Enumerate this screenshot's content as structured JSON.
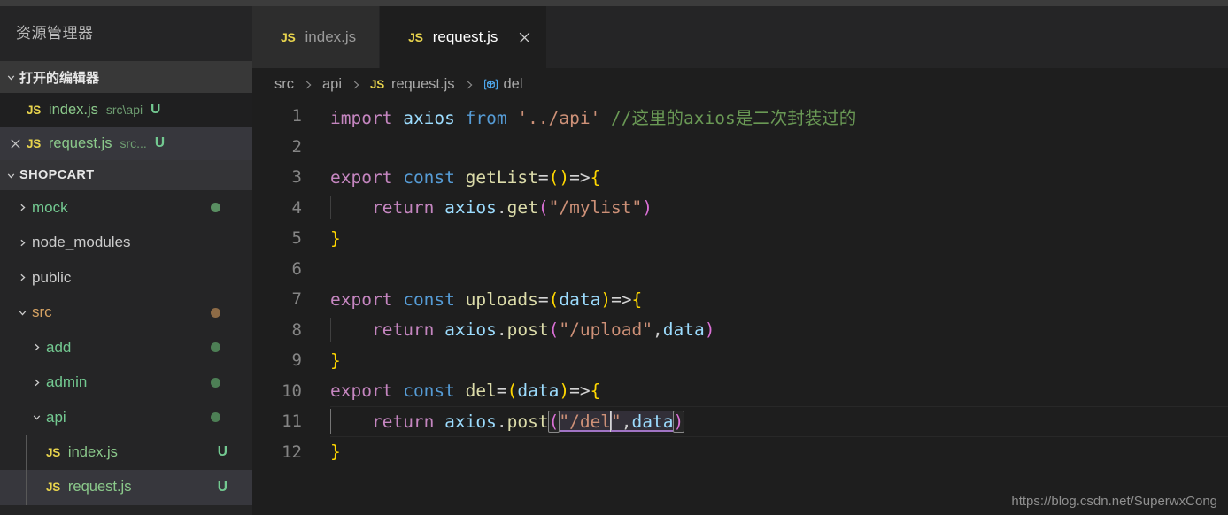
{
  "sidebar": {
    "title": "资源管理器",
    "open_editors": {
      "header": "打开的编辑器",
      "items": [
        {
          "icon": "js-file-icon",
          "name": "index.js",
          "path": "src\\api",
          "status": "U",
          "closable": false,
          "selected": false
        },
        {
          "icon": "js-file-icon",
          "name": "request.js",
          "path": "src...",
          "status": "U",
          "closable": true,
          "selected": true
        }
      ]
    },
    "project": {
      "header": "SHOPCART",
      "tree": [
        {
          "label": "mock",
          "type": "folder",
          "expanded": false,
          "depth": 0,
          "color": "green",
          "dot": "#5a8f62",
          "status": ""
        },
        {
          "label": "node_modules",
          "type": "folder",
          "expanded": false,
          "depth": 0,
          "color": "gray",
          "dot": "",
          "status": ""
        },
        {
          "label": "public",
          "type": "folder",
          "expanded": false,
          "depth": 0,
          "color": "gray",
          "dot": "",
          "status": ""
        },
        {
          "label": "src",
          "type": "folder",
          "expanded": true,
          "depth": 0,
          "color": "tan",
          "dot": "#8d6b46",
          "status": ""
        },
        {
          "label": "add",
          "type": "folder",
          "expanded": false,
          "depth": 1,
          "color": "green",
          "dot": "#4d7f55",
          "status": ""
        },
        {
          "label": "admin",
          "type": "folder",
          "expanded": false,
          "depth": 1,
          "color": "green",
          "dot": "#4d7f55",
          "status": ""
        },
        {
          "label": "api",
          "type": "folder",
          "expanded": true,
          "depth": 1,
          "color": "green",
          "dot": "#4d7f55",
          "status": ""
        },
        {
          "label": "index.js",
          "type": "file",
          "expanded": false,
          "depth": 2,
          "color": "green",
          "dot": "",
          "status": "U"
        },
        {
          "label": "request.js",
          "type": "file",
          "expanded": false,
          "depth": 2,
          "color": "green",
          "dot": "",
          "status": "U",
          "selected": true
        }
      ]
    }
  },
  "tabs": [
    {
      "label": "index.js",
      "icon": "js-file-icon",
      "active": false,
      "closable": false
    },
    {
      "label": "request.js",
      "icon": "js-file-icon",
      "active": true,
      "closable": true
    }
  ],
  "breadcrumb": {
    "parts": [
      "src",
      "api",
      "request.js",
      "del"
    ],
    "file_icon": "js-file-icon",
    "symbol_icon": "variable-symbol-icon"
  },
  "editor": {
    "language": "javascript",
    "current_line": 11,
    "cursor": {
      "line": 11,
      "column": 26
    },
    "line_numbers": [
      "1",
      "2",
      "3",
      "4",
      "5",
      "6",
      "7",
      "8",
      "9",
      "10",
      "11",
      "12"
    ],
    "lines": [
      "import axios from '../api' //这里的axios是二次封装过的",
      "",
      "export const getList=()=>{",
      "    return axios.get(\"/mylist\")",
      "}",
      "",
      "export const uploads=(data)=>{",
      "    return axios.post(\"/upload\",data)",
      "}",
      "export const del=(data)=>{",
      "    return axios.post(\"/del\",data)",
      "}"
    ],
    "comment_text": "//这里的axios是二次封装过的"
  },
  "watermark": "https://blog.csdn.net/SuperwxCong",
  "colors": {
    "editor_bg": "#1e1e1e",
    "sidebar_bg": "#252526",
    "tab_active_bg": "#1e1e1e",
    "tab_inactive_bg": "#2d2d2d",
    "selection_bg": "#37373d",
    "untracked_green": "#73c991",
    "modified_tan": "#d5a263",
    "js_badge_yellow": "#e8d44d",
    "keyword_purple": "#c586c0",
    "keyword_blue": "#569cd6",
    "string_orange": "#ce9178",
    "function_yellow": "#dcdcaa",
    "variable_blue": "#9cdcfe",
    "comment_green": "#6a9955"
  }
}
